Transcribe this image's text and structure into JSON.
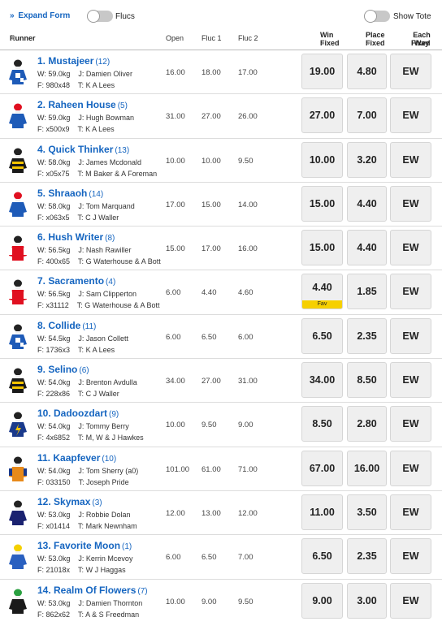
{
  "toolbar": {
    "expand_label": "Expand Form",
    "flucs_label": "Flucs",
    "show_tote_label": "Show Tote"
  },
  "columns": {
    "runner": "Runner",
    "open": "Open",
    "fluc1": "Fluc 1",
    "fluc2": "Fluc 2",
    "win_line1": "Win",
    "win_line2": "Fixed",
    "place_line1": "Place",
    "place_line2": "Fixed",
    "ew_line1": "Each Way",
    "ew_line2": "Fixed"
  },
  "labels": {
    "weight": "W:",
    "jockey": "J:",
    "form": "F:",
    "trainer": "T:",
    "ew": "EW",
    "fav": "Fav"
  },
  "silk_colors": [
    "#1e5bb8",
    "#1e5bb8",
    "#1a1a1a",
    "#2356b4",
    "#e01020",
    "#e01020",
    "#2356b4",
    "#1a3a8c",
    "#1a3a8c",
    "#1a3a8c",
    "#1a2270",
    "#2a60c0",
    "#1a1a1a"
  ],
  "runners": [
    {
      "number_name": "1. Mustajeer",
      "barrier": "(12)",
      "weight": "59.0kg",
      "jockey": "Damien Oliver",
      "form": "980x48",
      "trainer": "K A Lees",
      "open": "16.00",
      "fluc1": "18.00",
      "fluc2": "17.00",
      "win": "19.00",
      "place": "4.80",
      "silk": "blue-checked"
    },
    {
      "number_name": "2. Raheen House",
      "barrier": "(5)",
      "weight": "59.0kg",
      "jockey": "Hugh Bowman",
      "form": "x500x9",
      "trainer": "K A Lees",
      "open": "31.00",
      "fluc1": "27.00",
      "fluc2": "26.00",
      "win": "27.00",
      "place": "7.00",
      "silk": "blue-red-cap"
    },
    {
      "number_name": "4. Quick Thinker",
      "barrier": "(13)",
      "weight": "58.0kg",
      "jockey": "James Mcdonald",
      "form": "x05x75",
      "trainer": "M Baker & A Foreman",
      "open": "10.00",
      "fluc1": "10.00",
      "fluc2": "9.50",
      "win": "10.00",
      "place": "3.20",
      "silk": "yellow-black-hoops"
    },
    {
      "number_name": "5. Shraaoh",
      "barrier": "(14)",
      "weight": "58.0kg",
      "jockey": "Tom Marquand",
      "form": "x063x5",
      "trainer": "C J Waller",
      "open": "17.00",
      "fluc1": "15.00",
      "fluc2": "14.00",
      "win": "15.00",
      "place": "4.40",
      "silk": "blue-red-cap"
    },
    {
      "number_name": "6. Hush Writer",
      "barrier": "(8)",
      "weight": "56.5kg",
      "jockey": "Nash Rawiller",
      "form": "400x65",
      "trainer": "G Waterhouse & A Bott",
      "open": "15.00",
      "fluc1": "17.00",
      "fluc2": "16.00",
      "win": "15.00",
      "place": "4.40",
      "silk": "red-white"
    },
    {
      "number_name": "7. Sacramento",
      "barrier": "(4)",
      "weight": "56.5kg",
      "jockey": "Sam Clipperton",
      "form": "x31112",
      "trainer": "G Waterhouse & A Bott",
      "open": "6.00",
      "fluc1": "4.40",
      "fluc2": "4.60",
      "win": "4.40",
      "place": "1.85",
      "silk": "red-white",
      "fav": true
    },
    {
      "number_name": "8. Collide",
      "barrier": "(11)",
      "weight": "54.5kg",
      "jockey": "Jason Collett",
      "form": "1736x3",
      "trainer": "K A Lees",
      "open": "6.00",
      "fluc1": "6.50",
      "fluc2": "6.00",
      "win": "6.50",
      "place": "2.35",
      "silk": "blue-checked"
    },
    {
      "number_name": "9. Selino",
      "barrier": "(6)",
      "weight": "54.0kg",
      "jockey": "Brenton Avdulla",
      "form": "228x86",
      "trainer": "C J Waller",
      "open": "34.00",
      "fluc1": "27.00",
      "fluc2": "31.00",
      "win": "34.00",
      "place": "8.50",
      "silk": "yellow-black-hoops"
    },
    {
      "number_name": "10. Dadoozdart",
      "barrier": "(9)",
      "weight": "54.0kg",
      "jockey": "Tommy Berry",
      "form": "4x6852",
      "trainer": "M, W & J Hawkes",
      "open": "10.00",
      "fluc1": "9.50",
      "fluc2": "9.00",
      "win": "8.50",
      "place": "2.80",
      "silk": "navy-yellow"
    },
    {
      "number_name": "11. Kaapfever",
      "barrier": "(10)",
      "weight": "54.0kg",
      "jockey": "Tom Sherry (a0)",
      "form": "033150",
      "trainer": "Joseph Pride",
      "open": "101.00",
      "fluc1": "61.00",
      "fluc2": "71.00",
      "win": "67.00",
      "place": "16.00",
      "silk": "orange-navy"
    },
    {
      "number_name": "12. Skymax",
      "barrier": "(3)",
      "weight": "53.0kg",
      "jockey": "Robbie Dolan",
      "form": "x01414",
      "trainer": "Mark Newnham",
      "open": "12.00",
      "fluc1": "13.00",
      "fluc2": "12.00",
      "win": "11.00",
      "place": "3.50",
      "silk": "navy-plain"
    },
    {
      "number_name": "13. Favorite Moon",
      "barrier": "(1)",
      "weight": "53.0kg",
      "jockey": "Kerrin Mcevoy",
      "form": "21018x",
      "trainer": "W J Haggas",
      "open": "6.00",
      "fluc1": "6.50",
      "fluc2": "7.00",
      "win": "6.50",
      "place": "2.35",
      "silk": "blue-yellow"
    },
    {
      "number_name": "14. Realm Of Flowers",
      "barrier": "(7)",
      "weight": "53.0kg",
      "jockey": "Damien Thornton",
      "form": "862x62",
      "trainer": "A & S Freedman",
      "open": "10.00",
      "fluc1": "9.00",
      "fluc2": "9.50",
      "win": "9.00",
      "place": "3.00",
      "silk": "black-green"
    }
  ]
}
